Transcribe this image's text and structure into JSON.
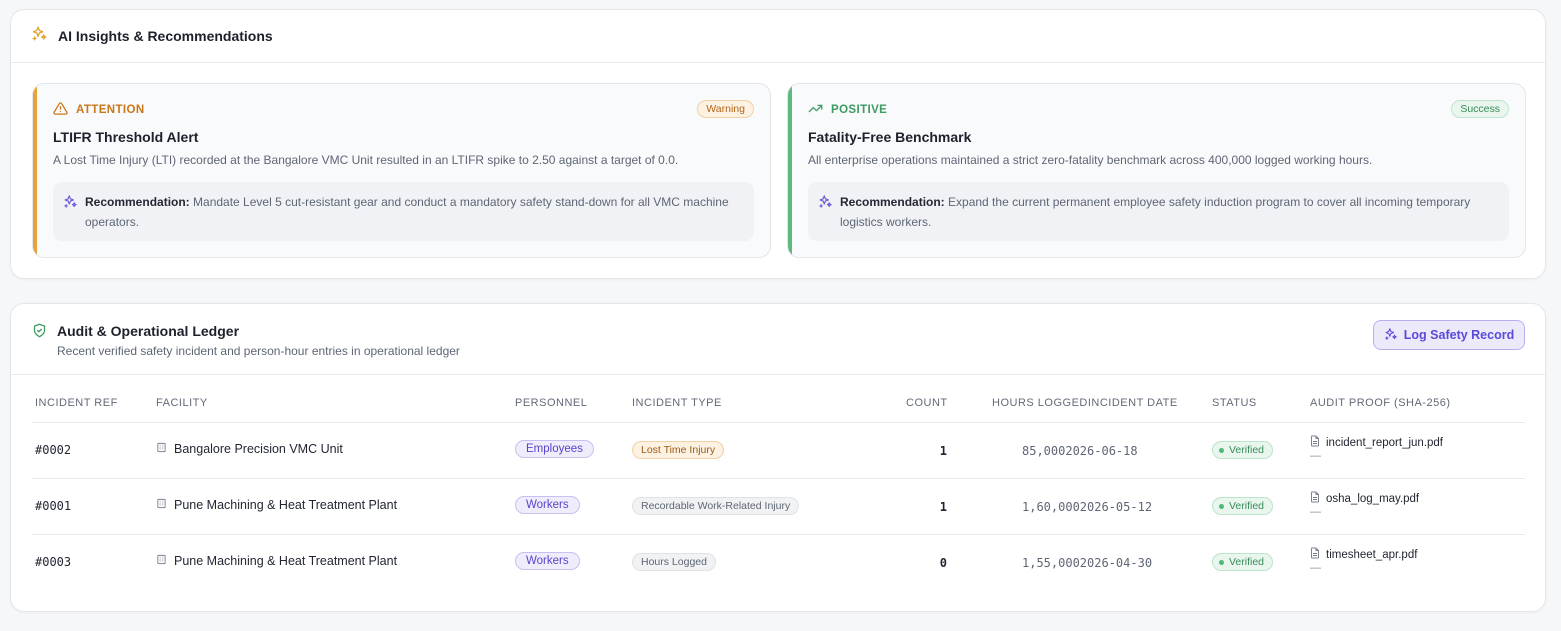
{
  "insights": {
    "title": "AI Insights & Recommendations",
    "cards": [
      {
        "kicker": "ATTENTION",
        "badge": "Warning",
        "title": "LTIFR Threshold Alert",
        "description": "A Lost Time Injury (LTI) recorded at the Bangalore VMC Unit resulted in an LTIFR spike to 2.50 against a target of 0.0.",
        "rec_label": "Recommendation:",
        "rec_text": " Mandate Level 5 cut-resistant gear and conduct a mandatory safety stand-down for all VMC machine operators.",
        "accent": "#e6a23c",
        "icon": "warning-triangle-icon"
      },
      {
        "kicker": "POSITIVE",
        "badge": "Success",
        "title": "Fatality-Free Benchmark",
        "description": "All enterprise operations maintained a strict zero-fatality benchmark across 400,000 logged working hours.",
        "rec_label": "Recommendation:",
        "rec_text": " Expand the current permanent employee safety induction program to cover all incoming temporary logistics workers.",
        "accent": "#5fb87f",
        "icon": "trending-up-icon"
      }
    ]
  },
  "ledger": {
    "title": "Audit & Operational Ledger",
    "subtitle": "Recent verified safety incident and person-hour entries in operational ledger",
    "log_button": "Log Safety Record",
    "columns": {
      "ref": "INCIDENT REF",
      "facility": "FACILITY",
      "personnel": "PERSONNEL",
      "type": "INCIDENT TYPE",
      "count": "COUNT",
      "hours_date": "HOURS LOGGEDINCIDENT DATE",
      "status": "STATUS",
      "proof": "AUDIT PROOF (SHA-256)"
    },
    "rows": [
      {
        "ref": "#0002",
        "facility": "Bangalore Precision VMC Unit",
        "personnel": "Employees",
        "type": "Lost Time Injury",
        "type_style": "warn",
        "count": "1",
        "hours_date": "85,0002026-06-18",
        "status": "Verified",
        "file": "incident_report_jun.pdf",
        "hash": "—"
      },
      {
        "ref": "#0001",
        "facility": "Pune Machining & Heat Treatment Plant",
        "personnel": "Workers",
        "type": "Recordable Work-Related Injury",
        "type_style": "gray",
        "count": "1",
        "hours_date": "1,60,0002026-05-12",
        "status": "Verified",
        "file": "osha_log_may.pdf",
        "hash": "—"
      },
      {
        "ref": "#0003",
        "facility": "Pune Machining & Heat Treatment Plant",
        "personnel": "Workers",
        "type": "Hours Logged",
        "type_style": "gray",
        "count": "0",
        "hours_date": "1,55,0002026-04-30",
        "status": "Verified",
        "file": "timesheet_apr.pdf",
        "hash": "—"
      }
    ]
  }
}
